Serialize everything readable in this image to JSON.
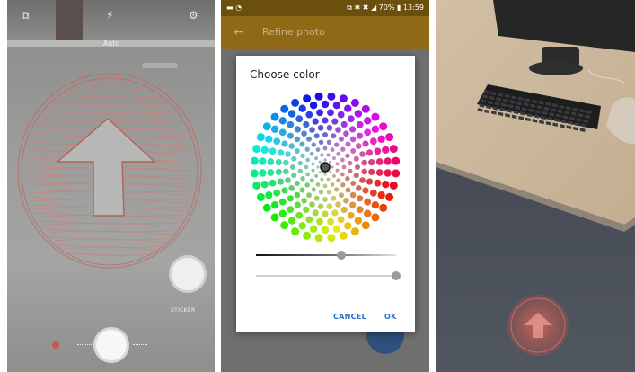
{
  "camera": {
    "flash_mode": "Auto",
    "sticker_label": "STICKER"
  },
  "editor": {
    "status_bar": {
      "left_icons": "▬ ◔",
      "right_text": "⧉ ✱ ✖ ◢ 70% ▮ 13:59"
    },
    "app_title": "Refine photo",
    "dialog": {
      "title": "Choose color",
      "cancel_label": "CANCEL",
      "ok_label": "OK",
      "brightness_level": 0.61,
      "opacity_level": 1.0
    }
  },
  "colors": {
    "app_bar": "#8e6a17",
    "status_bar": "#6b4f0c",
    "accent": "#2c6cc5",
    "fab": "#2f4f7c"
  }
}
